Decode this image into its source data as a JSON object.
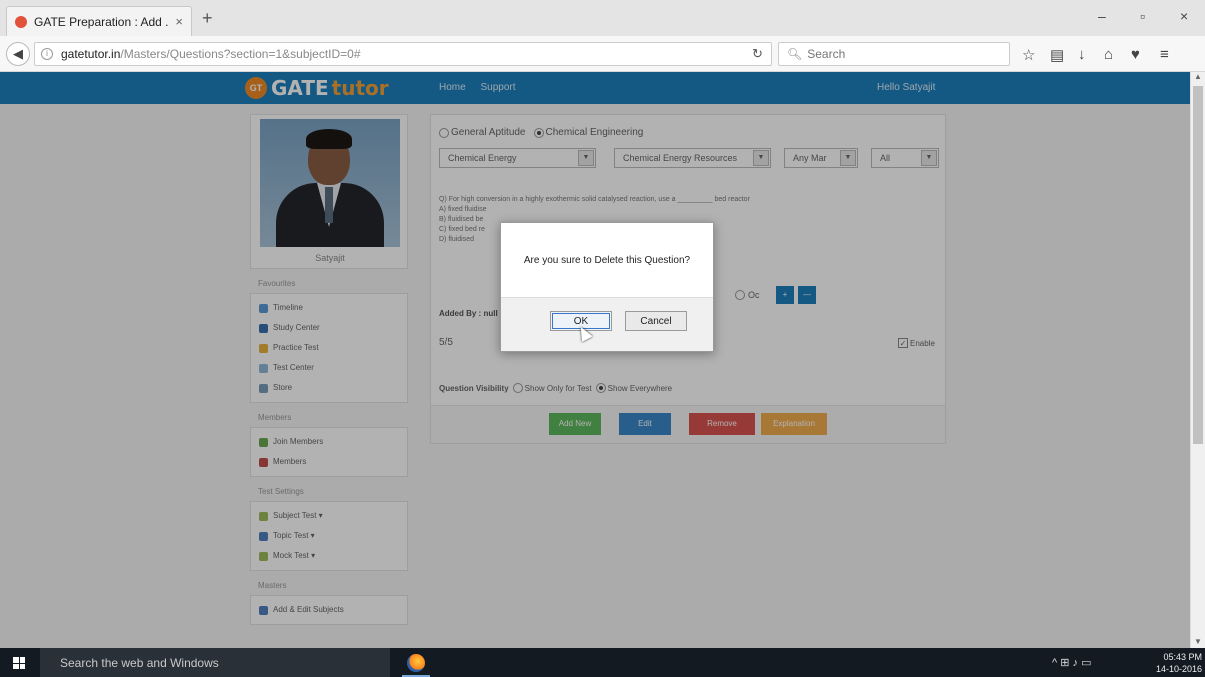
{
  "browser": {
    "tab_title": "GATE Preparation : Add ...",
    "tab_close": "×",
    "new_tab": "+",
    "window_buttons": [
      "–",
      "▫",
      "×"
    ],
    "url_host": "gatetutor.in",
    "url_path": "/Masters/Questions?section=1&subjectID=0#",
    "search_placeholder": "Search",
    "back": "◀"
  },
  "site": {
    "logo_badge": "GT",
    "logo_main": "GATE",
    "logo_accent": "tutor",
    "menu": [
      "Home",
      "Support"
    ],
    "greeting": "Hello Satyajit",
    "brand_color": "#1d7fbd"
  },
  "sidebar": {
    "profile_name": "Satyajit",
    "section1": "Favourites",
    "items1": [
      "Timeline",
      "Study Center",
      "Practice Test",
      "Test Center",
      "Store"
    ],
    "section2": "Members",
    "items2": [
      "Join Members",
      "Members"
    ],
    "section3": "Test Settings",
    "items3": [
      "Subject Test ▾",
      "Topic Test ▾",
      "Mock Test ▾"
    ],
    "section4": "Masters",
    "items4": [
      "Add & Edit Subjects"
    ]
  },
  "main": {
    "radio_general": "General Aptitude",
    "radio_chemical": "Chemical Engineering",
    "select_subject": "Chemical Energy",
    "select_topic": "Chemical Energy Resources",
    "select_marks": "Any Mar",
    "select_level": "All",
    "question": "Q) For high conversion in a highly exothermic solid catalysed reaction, use a _________ bed reactor",
    "option_a": "A) fixed fluidise",
    "option_b": "B) fluidised be",
    "option_c": "C) fixed bed re",
    "option_d": "D) fluidised",
    "option_circle": "Oc",
    "added_by": "Added By : null",
    "page_counter": "5/5",
    "enable_label": "Enable",
    "visibility_label": "Question Visibility",
    "visibility_test": "Show Only for Test",
    "visibility_all": "Show Everywhere",
    "btn_add": "Add New",
    "btn_edit": "Edit",
    "btn_remove": "Remove",
    "btn_explanation": "Explanation"
  },
  "dialog": {
    "message": "Are you sure to Delete this Question?",
    "ok": "OK",
    "cancel": "Cancel"
  },
  "taskbar": {
    "search_text": "Search the web and Windows",
    "time": "05:43 PM",
    "date": "14-10-2016"
  }
}
